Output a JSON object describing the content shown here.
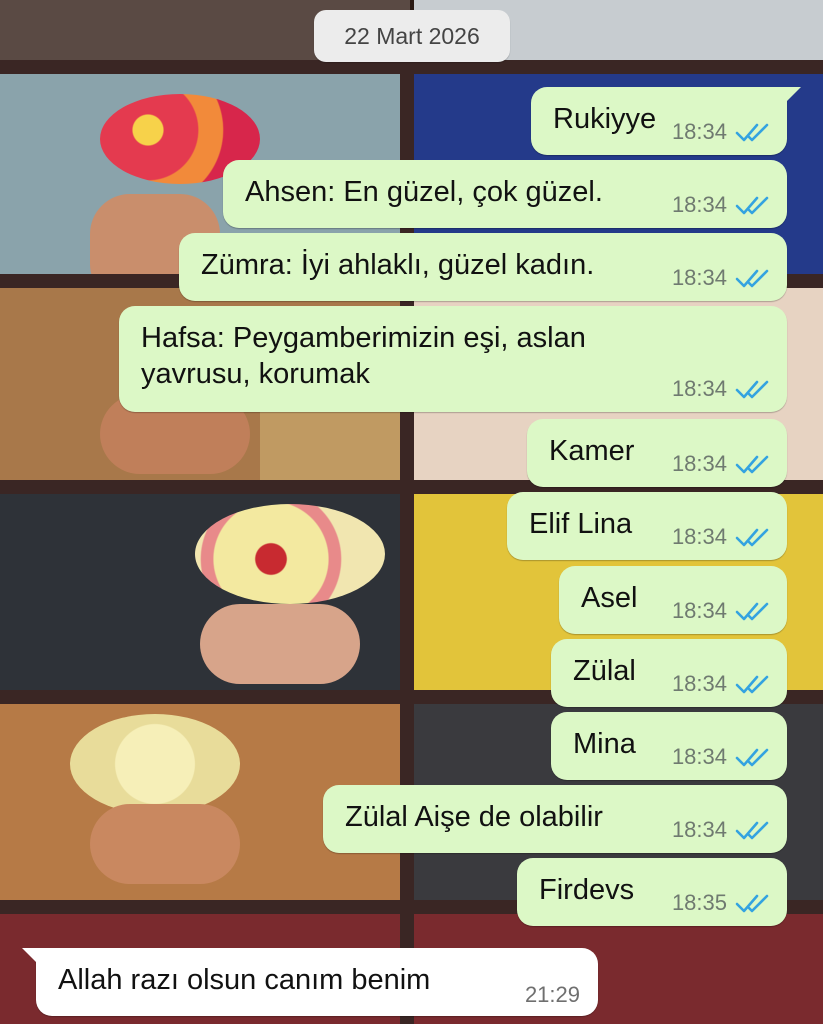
{
  "chat": {
    "date_chip": "22 Mart 2026",
    "outgoing": [
      {
        "text": "Rukiyye",
        "time": "18:34",
        "status": "read"
      },
      {
        "text": "Ahsen: En güzel, çok güzel.",
        "time": "18:34",
        "status": "read"
      },
      {
        "text": "Zümra: İyi ahlaklı, güzel kadın.",
        "time": "18:34",
        "status": "read"
      },
      {
        "text": "Hafsa: Peygamberimizin eşi, aslan yavrusu, korumak",
        "time": "18:34",
        "status": "read"
      },
      {
        "text": "Kamer",
        "time": "18:34",
        "status": "read"
      },
      {
        "text": "Elif Lina",
        "time": "18:34",
        "status": "read"
      },
      {
        "text": "Asel",
        "time": "18:34",
        "status": "read"
      },
      {
        "text": "Zülal",
        "time": "18:34",
        "status": "read"
      },
      {
        "text": "Mina",
        "time": "18:34",
        "status": "read"
      },
      {
        "text": "Zülal Aişe de olabilir",
        "time": "18:34",
        "status": "read"
      },
      {
        "text": "Firdevs",
        "time": "18:35",
        "status": "read"
      }
    ],
    "incoming": [
      {
        "text": "Allah razı olsun canım benim",
        "time": "21:29"
      }
    ]
  },
  "colors": {
    "outgoing_bubble": "#dcf8c6",
    "incoming_bubble": "#ffffff",
    "read_ticks": "#34a3e0",
    "date_chip": "#ececec"
  },
  "icons": {
    "read_status": "double-check-icon",
    "wallpaper": "bouquet-collage"
  }
}
